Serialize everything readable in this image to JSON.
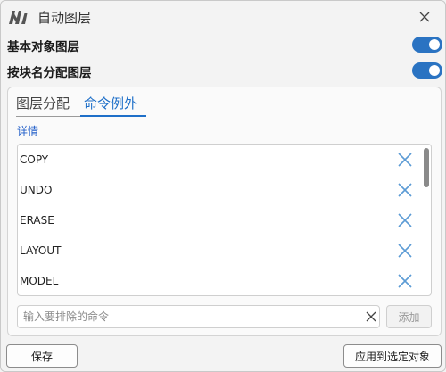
{
  "window": {
    "title": "自动图层"
  },
  "toggles": [
    {
      "label": "基本对象图层",
      "on": true
    },
    {
      "label": "按块名分配图层",
      "on": true
    }
  ],
  "tabs": [
    {
      "label": "图层分配",
      "active": false
    },
    {
      "label": "命令例外",
      "active": true
    }
  ],
  "details_link": "详情",
  "exceptions": [
    "COPY",
    "UNDO",
    "ERASE",
    "LAYOUT",
    "MODEL"
  ],
  "input": {
    "placeholder": "输入要排除的命令",
    "value": ""
  },
  "add_label": "添加",
  "footer": {
    "save_label": "保存",
    "apply_label": "应用到选定对象"
  },
  "colors": {
    "accent": "#1e6fc8",
    "toggle_on": "#2a73c2",
    "remove_icon": "#5b9bd5"
  },
  "icons": {
    "app": "app-logo-icon",
    "close": "close-icon",
    "remove": "remove-x-icon",
    "clear": "clear-input-icon"
  }
}
